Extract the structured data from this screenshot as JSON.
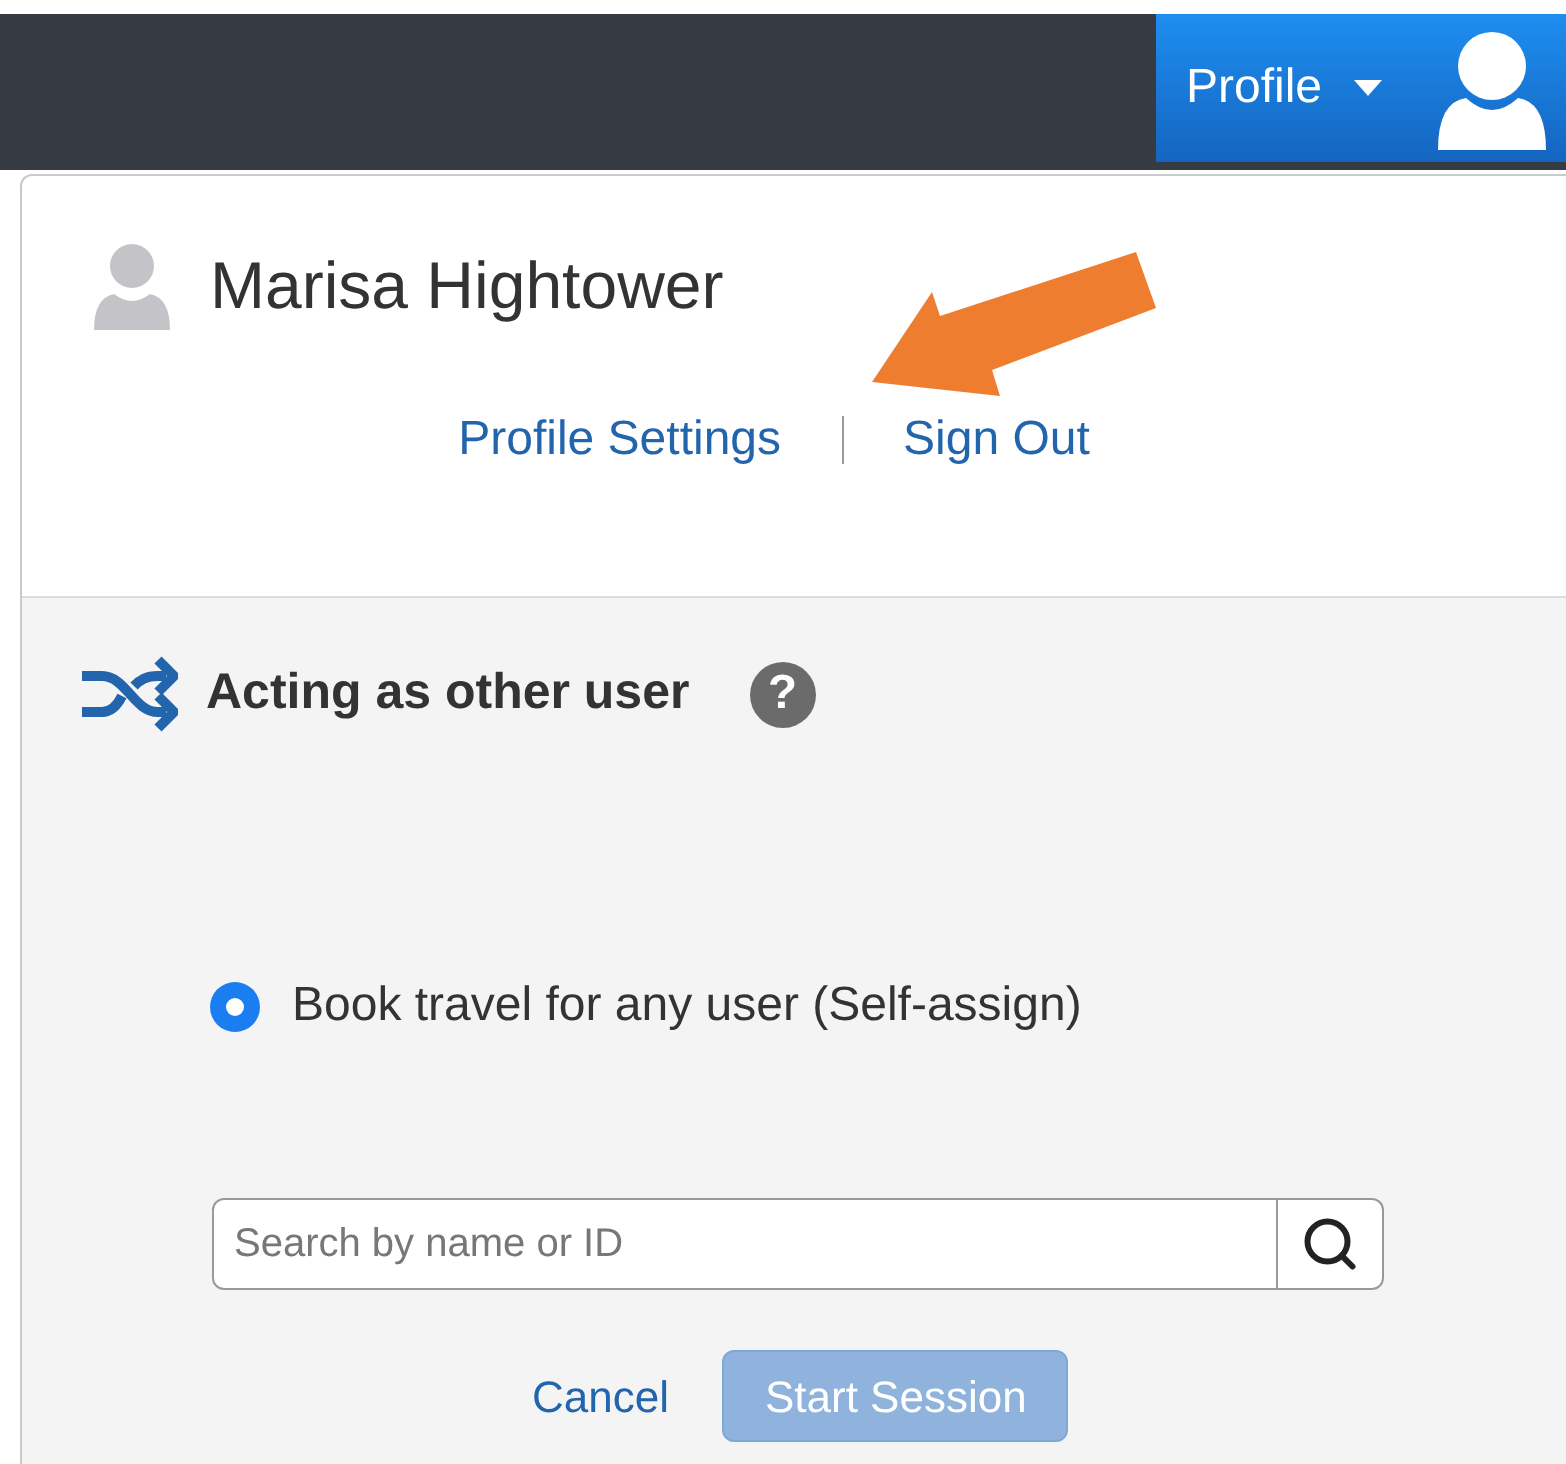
{
  "header": {
    "profile_button": "Profile"
  },
  "user": {
    "name": "Marisa Hightower"
  },
  "links": [
    "Profile Settings",
    "Sign Out"
  ],
  "acting": {
    "title": "Acting as other user",
    "help": "?",
    "options": [
      {
        "label": "Book travel for any user (Self-assign)",
        "selected": true
      }
    ],
    "search": {
      "placeholder": "Search by name or ID"
    },
    "cancel": "Cancel",
    "start": {
      "label": "Start Session",
      "disabled": true
    }
  }
}
